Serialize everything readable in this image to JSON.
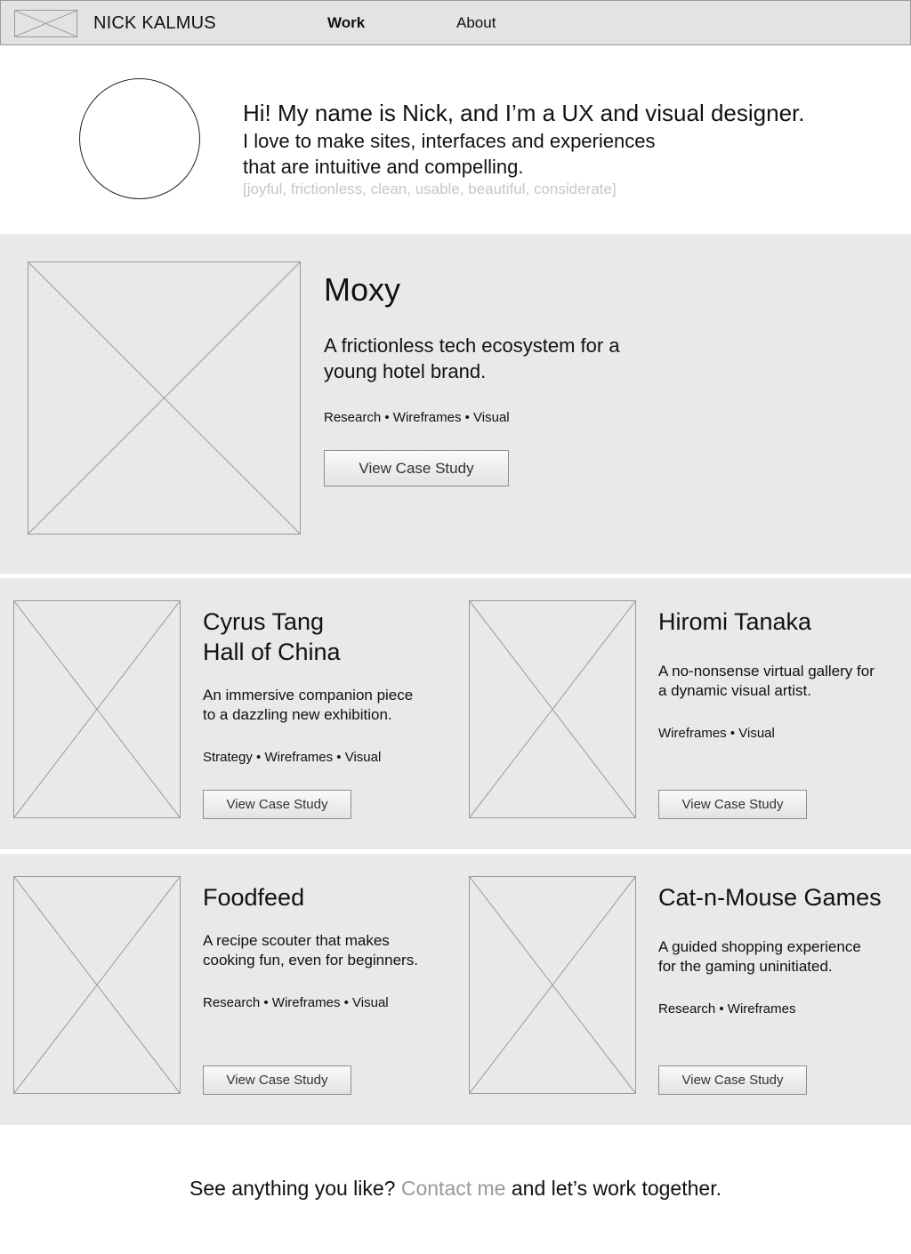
{
  "header": {
    "logo_icon": "image-placeholder-icon",
    "site_name": "NICK KALMUS",
    "nav": {
      "work": "Work",
      "about": "About"
    }
  },
  "intro": {
    "avatar_icon": "avatar-placeholder",
    "headline": "Hi! My name is Nick, and I’m a UX and visual designer.",
    "line1": "I love to make sites, interfaces and experiences",
    "line2": "that are intuitive and compelling.",
    "tags": "[joyful, frictionless, clean, usable, beautiful, considerate]"
  },
  "featured": {
    "title": "Moxy",
    "desc_line1": "A frictionless tech ecosystem for a",
    "desc_line2": "young hotel brand.",
    "tags": "Research • Wireframes • Visual",
    "button": "View Case Study"
  },
  "projects": [
    {
      "title_line1": "Cyrus Tang",
      "title_line2": "Hall of China",
      "desc_line1": "An immersive companion piece",
      "desc_line2": "to a dazzling new exhibition.",
      "tags": "Strategy • Wireframes • Visual",
      "button": "View Case Study"
    },
    {
      "title_line1": "Hiromi Tanaka",
      "desc_line1": "A no-nonsense virtual gallery for",
      "desc_line2": "a dynamic visual artist.",
      "tags": "Wireframes • Visual",
      "button": "View Case Study"
    },
    {
      "title_line1": "Foodfeed",
      "desc_line1": "A recipe scouter that makes",
      "desc_line2": "cooking fun, even for beginners.",
      "tags": "Research • Wireframes • Visual",
      "button": "View Case Study"
    },
    {
      "title_line1": "Cat-n-Mouse Games",
      "desc_line1": "A guided shopping experience",
      "desc_line2": "for the gaming uninitiated.",
      "tags": "Research • Wireframes",
      "button": "View Case Study"
    }
  ],
  "footer": {
    "before": "See anything you like? ",
    "link": "Contact me",
    "after": " and let’s work together."
  },
  "colors": {
    "header_bg": "#e3e3e3",
    "panel_bg": "#e9e9e9",
    "placeholder_line": "#9a9a9a",
    "muted_text": "#c6c6c6",
    "link_text": "#999999"
  }
}
